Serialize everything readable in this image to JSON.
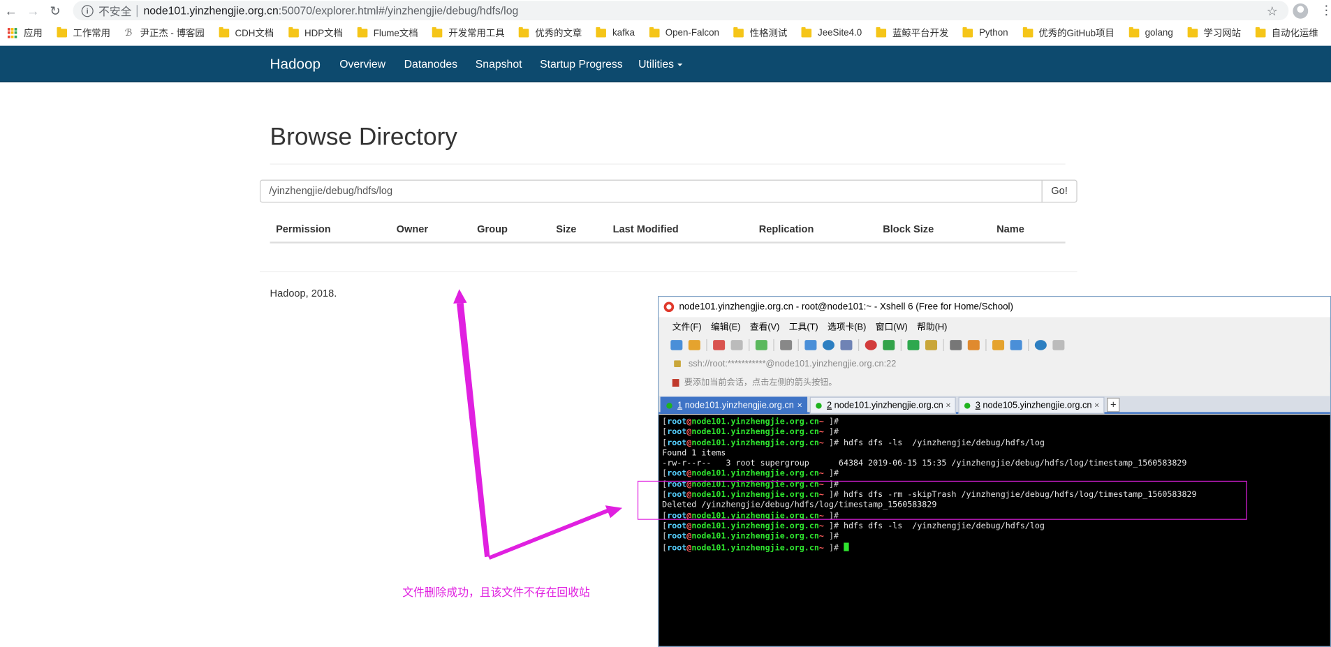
{
  "browser": {
    "insecure_label": "不安全",
    "url_host": "node101.yinzhengjie.org.cn",
    "url_rest": ":50070/explorer.html#/yinzhengjie/debug/hdfs/log",
    "bookmarks": [
      "应用",
      "工作常用",
      "尹正杰 - 博客园",
      "CDH文档",
      "HDP文档",
      "Flume文档",
      "开发常用工具",
      "优秀的文章",
      "kafka",
      "Open-Falcon",
      "性格测试",
      "JeeSite4.0",
      "蓝鲸平台开发",
      "Python",
      "优秀的GitHub项目",
      "golang",
      "学习网站",
      "自动化运维"
    ]
  },
  "navbar": {
    "brand": "Hadoop",
    "links": [
      "Overview",
      "Datanodes",
      "Snapshot",
      "Startup Progress",
      "Utilities"
    ]
  },
  "page": {
    "title": "Browse Directory",
    "path_value": "/yinzhengjie/debug/hdfs/log",
    "go_label": "Go!",
    "columns": [
      "Permission",
      "Owner",
      "Group",
      "Size",
      "Last Modified",
      "Replication",
      "Block Size",
      "Name"
    ],
    "footer": "Hadoop, 2018."
  },
  "annotation": {
    "text": "文件删除成功，且该文件不存在回收站",
    "color": "#e020e0"
  },
  "xshell": {
    "title": "node101.yinzhengjie.org.cn - root@node101:~ - Xshell 6 (Free for Home/School)",
    "menu": [
      "文件(F)",
      "编辑(E)",
      "查看(V)",
      "工具(T)",
      "选项卡(B)",
      "窗口(W)",
      "帮助(H)"
    ],
    "address": "ssh://root:***********@node101.yinzhengjie.org.cn:22",
    "hint": "要添加当前会话，点击左侧的箭头按钮。",
    "tabs": [
      {
        "num": "1",
        "label": " node101.yinzhengjie.org.cn"
      },
      {
        "num": "2",
        "label": " node101.yinzhengjie.org.cn"
      },
      {
        "num": "3",
        "label": " node105.yinzhengjie.org.cn"
      }
    ],
    "plus": "+",
    "prompt": {
      "open": "[",
      "user": "root",
      "at": "@",
      "host": "node101.yinzhengjie.org.cn",
      "dir": "~",
      "close": "]#"
    },
    "lines": [
      {
        "type": "prompt",
        "cmd": ""
      },
      {
        "type": "prompt",
        "cmd": ""
      },
      {
        "type": "prompt",
        "cmd": " hdfs dfs -ls  /yinzhengjie/debug/hdfs/log"
      },
      {
        "type": "out",
        "text": "Found 1 items"
      },
      {
        "type": "out",
        "text": "-rw-r--r--   3 root supergroup      64384 2019-06-15 15:35 /yinzhengjie/debug/hdfs/log/timestamp_1560583829"
      },
      {
        "type": "prompt",
        "cmd": ""
      },
      {
        "type": "prompt",
        "cmd": ""
      },
      {
        "type": "prompt",
        "cmd": " hdfs dfs -rm -skipTrash /yinzhengjie/debug/hdfs/log/timestamp_1560583829"
      },
      {
        "type": "out",
        "text": "Deleted /yinzhengjie/debug/hdfs/log/timestamp_1560583829"
      },
      {
        "type": "prompt",
        "cmd": ""
      },
      {
        "type": "prompt",
        "cmd": " hdfs dfs -ls  /yinzhengjie/debug/hdfs/log"
      },
      {
        "type": "prompt",
        "cmd": ""
      },
      {
        "type": "prompt",
        "cmd": " ",
        "cursor": true
      }
    ]
  }
}
